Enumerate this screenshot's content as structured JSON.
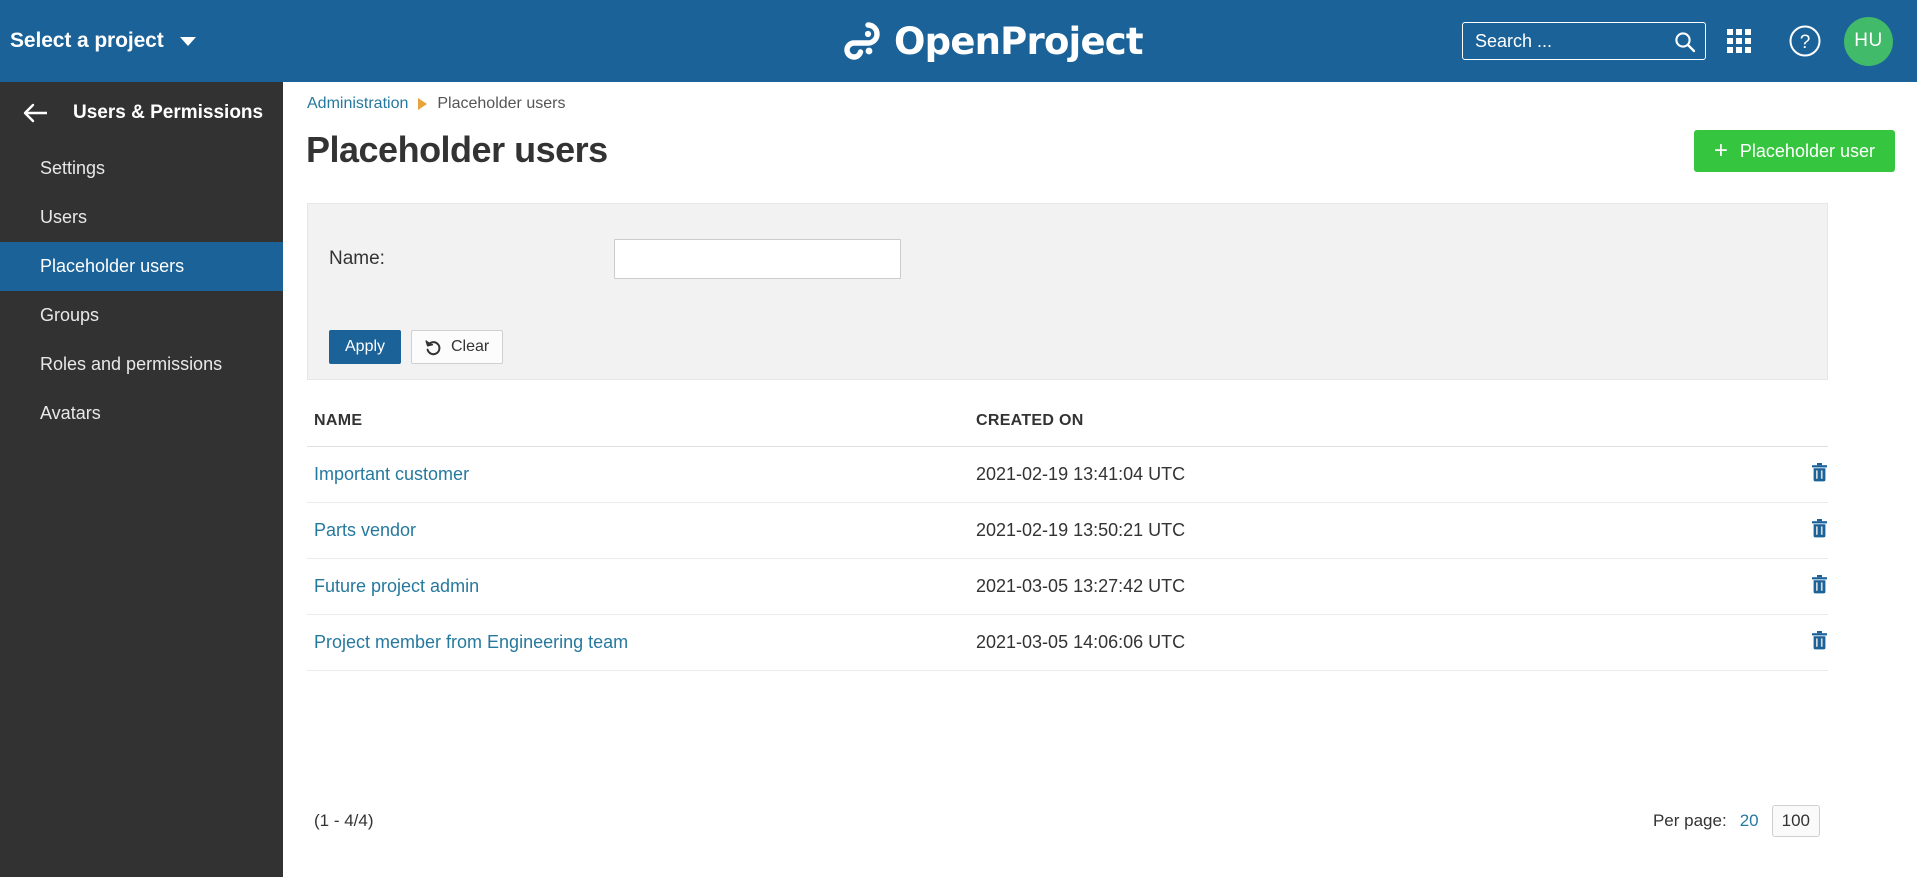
{
  "header": {
    "project_selector_label": "Select a project",
    "brand_name": "OpenProject",
    "search_placeholder": "Search ...",
    "search_value": "",
    "avatar_initials": "HU",
    "accent_color": "#1a6298",
    "avatar_color": "#41ba69"
  },
  "sidebar": {
    "title": "Users & Permissions",
    "items": [
      {
        "label": "Settings",
        "active": false
      },
      {
        "label": "Users",
        "active": false
      },
      {
        "label": "Placeholder users",
        "active": true
      },
      {
        "label": "Groups",
        "active": false
      },
      {
        "label": "Roles and permissions",
        "active": false
      },
      {
        "label": "Avatars",
        "active": false
      }
    ]
  },
  "breadcrumb": {
    "root": "Administration",
    "current": "Placeholder users"
  },
  "page": {
    "title": "Placeholder users",
    "add_button_label": "Placeholder user",
    "add_button_color": "#35c53f"
  },
  "filter": {
    "name_label": "Name:",
    "name_value": "",
    "name_placeholder": "",
    "apply_label": "Apply",
    "clear_label": "Clear"
  },
  "table": {
    "columns": [
      "NAME",
      "CREATED ON"
    ],
    "rows": [
      {
        "name": "Important customer",
        "created_on": "2021-02-19 13:41:04 UTC"
      },
      {
        "name": "Parts vendor",
        "created_on": "2021-02-19 13:50:21 UTC"
      },
      {
        "name": "Future project admin",
        "created_on": "2021-03-05 13:27:42 UTC"
      },
      {
        "name": "Project member from Engineering team",
        "created_on": "2021-03-05 14:06:06 UTC"
      }
    ]
  },
  "pagination": {
    "range": "(1 - 4/4)",
    "per_page_label": "Per page:",
    "options": [
      {
        "value": "20",
        "selected": false
      },
      {
        "value": "100",
        "selected": true
      }
    ]
  }
}
